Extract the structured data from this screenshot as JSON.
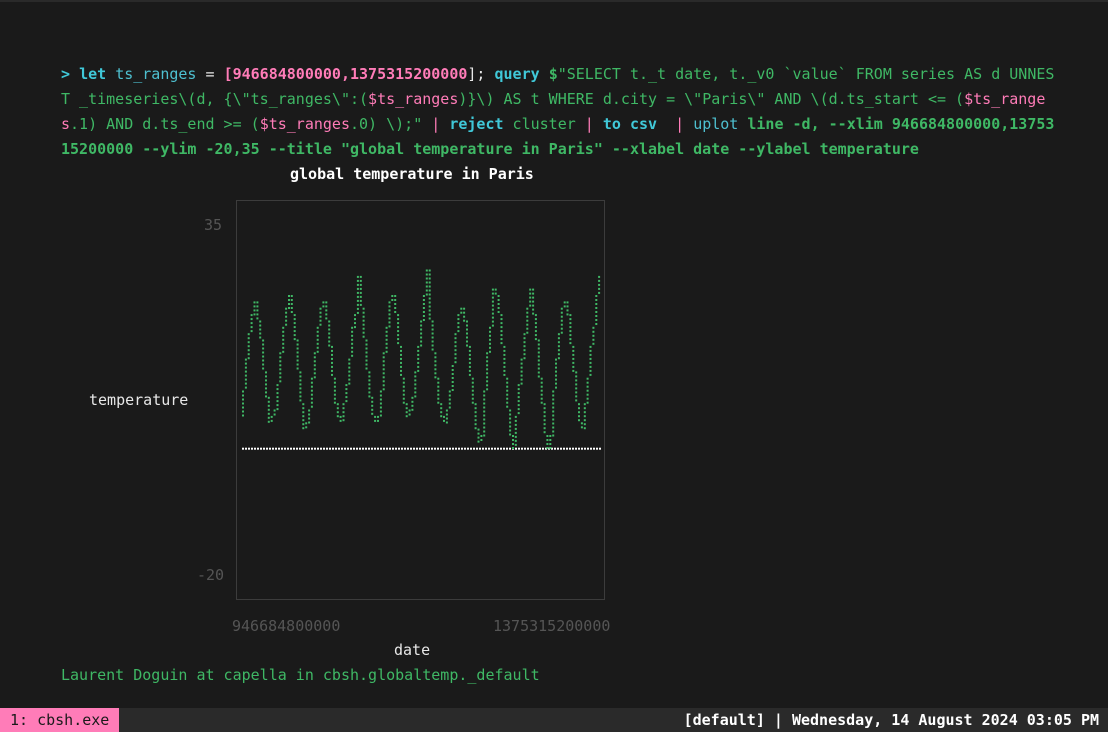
{
  "terminal": {
    "prompt": ">",
    "command": {
      "let_kw": "let",
      "var_name": "ts_ranges",
      "assign": " = ",
      "range_open": "[",
      "range_start": "946684800000",
      "range_comma": ",",
      "range_end": "1375315200000",
      "range_close": "];",
      "query_kw": "query",
      "dollar": "$",
      "query_part1": "\"SELECT t._t date, t._v0 `value` FROM series AS d UNNEST _timeseries\\(d, {\\\"ts_ranges\\\":(",
      "query_var1": "$ts_ranges",
      "query_part2": ")}\\) AS t WHERE d.city = \\\"Paris\\\" AND \\(d.ts_start <= (",
      "query_var2": "$ts_ranges",
      "query_part3": ".1) AND d.ts_end >= (",
      "query_var3": "$ts_ranges",
      "query_part4": ".0) \\);\"",
      "pipe1": " | ",
      "reject_kw": "reject",
      "reject_arg": " cluster",
      "pipe2": " | ",
      "tocsv_kw": "to csv",
      "pipe3": "  | ",
      "uplot_kw": "uplot",
      "uplot_args": " line -d, --xlim 946684800000,1375315200000 --ylim -20,35 --title \"global temperature in Paris\" --xlabel date --ylabel temperature"
    },
    "status": "Laurent Doguin at capella in cbsh.globaltemp._default"
  },
  "chart_data": {
    "type": "line",
    "title": "global temperature in Paris",
    "xlabel": "date",
    "ylabel": "temperature",
    "xlim": [
      946684800000,
      1375315200000
    ],
    "ylim": [
      -20,
      35
    ],
    "xtick_labels": [
      "946684800000",
      "1375315200000"
    ],
    "ytick_labels": [
      "35",
      "-20"
    ],
    "series": [
      {
        "color": "#3fb865",
        "values": [
          5,
          9,
          14,
          18,
          21,
          23,
          20,
          17,
          12,
          8,
          4,
          5,
          6,
          10,
          15,
          19,
          22,
          24,
          21,
          17,
          12,
          7,
          3,
          4,
          6,
          11,
          15,
          19,
          22,
          23,
          20,
          16,
          11,
          7,
          5,
          4,
          7,
          10,
          14,
          19,
          21,
          27,
          22,
          17,
          12,
          8,
          5,
          4,
          5,
          9,
          15,
          19,
          23,
          24,
          21,
          16,
          11,
          7,
          5,
          6,
          8,
          12,
          16,
          20,
          24,
          28,
          20,
          15,
          11,
          7,
          5,
          4,
          6,
          9,
          13,
          18,
          21,
          22,
          20,
          16,
          11,
          7,
          3,
          1,
          2,
          9,
          15,
          19,
          25,
          24,
          21,
          16,
          11,
          6,
          2,
          0,
          5,
          10,
          14,
          18,
          22,
          25,
          21,
          17,
          11,
          7,
          2,
          0,
          2,
          9,
          14,
          18,
          22,
          23,
          21,
          16,
          12,
          7,
          4,
          3,
          7,
          11,
          16,
          19,
          24,
          27
        ]
      },
      {
        "color": "#ffffff",
        "values": [
          0,
          0
        ]
      }
    ]
  },
  "tmux": {
    "tab_label": "1: cbsh.exe",
    "session": "[default]",
    "separator": " | ",
    "datetime": "Wednesday, 14 August 2024 03:05 PM"
  }
}
